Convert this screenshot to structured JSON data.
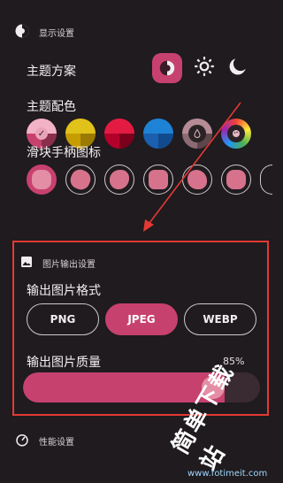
{
  "display_settings": {
    "section_title": "显示设置",
    "theme_scheme_label": "主题方案",
    "theme_options": [
      "auto-theme-icon",
      "sun-icon",
      "moon-icon"
    ],
    "theme_selected": "auto-theme-icon",
    "theme_color_label": "主题配色",
    "color_swatches": [
      {
        "name": "pink",
        "top": "#f3b3c6",
        "bottom": "#c7416f",
        "accent": "#8a2f4b",
        "selected": true
      },
      {
        "name": "yellow",
        "top": "#e1c21a",
        "bottom": "#c79c00",
        "accent": "#9b7a00",
        "selected": false
      },
      {
        "name": "crimson",
        "top": "#e31b43",
        "bottom": "#b3002a",
        "accent": "#7a001c",
        "selected": false
      },
      {
        "name": "blue",
        "top": "#1e83d6",
        "bottom": "#1a5fb0",
        "accent": "#114b8d",
        "selected": false
      },
      {
        "name": "mauve",
        "top": "#b58b95",
        "bottom": "#8d6b73",
        "accent": "#5e454b",
        "selected": false
      },
      {
        "name": "rainbow",
        "top": "#f44336",
        "bottom": "#2196f3",
        "accent": "#9c27b0",
        "selected": false
      }
    ],
    "slider_handle_label": "滑块手柄图标",
    "handle_shapes": [
      "flower",
      "sunburst",
      "blob",
      "octagon",
      "rounded",
      "cookie",
      "partial"
    ]
  },
  "image_output": {
    "section_title": "图片输出设置",
    "format_label": "输出图片格式",
    "formats": [
      "PNG",
      "JPEG",
      "WEBP"
    ],
    "selected_format": "JPEG",
    "quality_label": "输出图片质量",
    "quality_value_text": "85%",
    "quality_fraction": 0.85
  },
  "performance": {
    "section_title": "性能设置"
  },
  "watermark": {
    "text_cn": "简单下载站",
    "url": "www.fotimeit.com"
  },
  "colors": {
    "accent": "#c7416f",
    "background": "#1f1b1e",
    "annotation_red": "#e53935"
  }
}
